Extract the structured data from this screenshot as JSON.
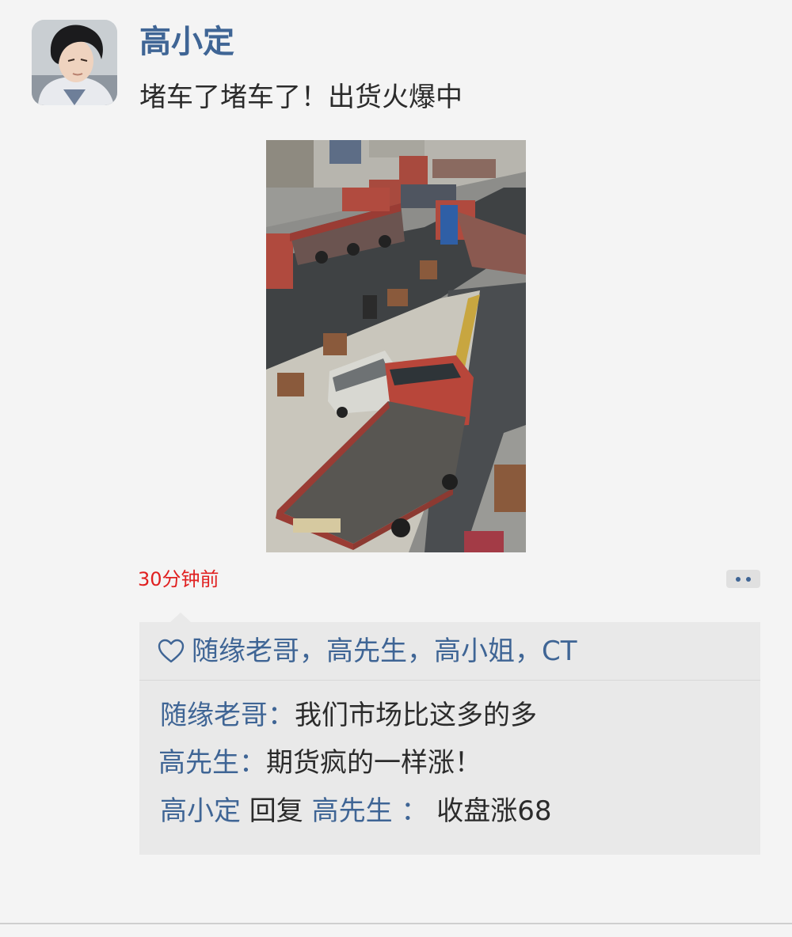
{
  "post": {
    "author": "高小定",
    "text": "堵车了堵车了！出货火爆中",
    "time": "30分钟前",
    "more_icon": "ellipsis-icon",
    "avatar_icon": "user-avatar"
  },
  "likes": {
    "icon": "heart-outline-icon",
    "text": "随缘老哥，高先生，高小姐，CT"
  },
  "comments": [
    {
      "name": "随缘老哥",
      "sep": "：",
      "text": "我们市场比这多的多"
    },
    {
      "name": "高先生",
      "sep": "：",
      "text": "期货疯的一样涨！"
    },
    {
      "name": "高小定",
      "reply_word": " 回复 ",
      "reply_to": "高先生",
      "sep": " ： ",
      "text": "收盘涨68"
    }
  ],
  "colors": {
    "link": "#3f6595",
    "time": "#e02020",
    "background": "#f4f4f4",
    "panel": "#e9e9e9"
  }
}
